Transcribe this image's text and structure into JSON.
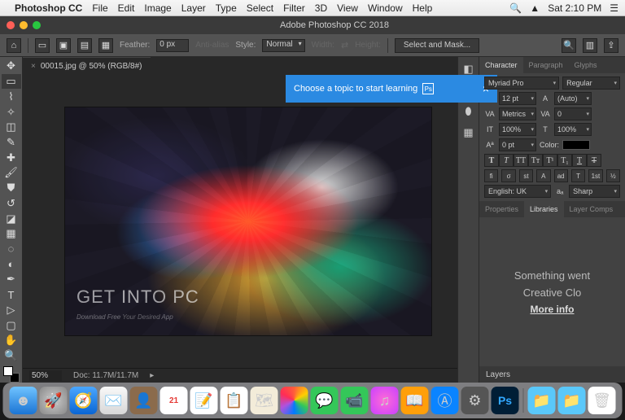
{
  "mac_menu": {
    "app": "Photoshop CC",
    "items": [
      "File",
      "Edit",
      "Image",
      "Layer",
      "Type",
      "Select",
      "Filter",
      "3D",
      "View",
      "Window",
      "Help"
    ],
    "time": "Sat 2:10 PM"
  },
  "window": {
    "title": "Adobe Photoshop CC 2018"
  },
  "options": {
    "feather_label": "Feather:",
    "feather_value": "0 px",
    "antialias_label": "Anti-alias",
    "style_label": "Style:",
    "style_value": "Normal",
    "width_label": "Width:",
    "height_label": "Height:",
    "mask_button": "Select and Mask..."
  },
  "document": {
    "tab_label": "00015.jpg @ 50% (RGB/8#)",
    "watermark": "GET INTO PC",
    "watermark_sub": "Download Free Your Desired App",
    "zoom": "50%",
    "doc_info": "Doc: 11.7M/11.7M"
  },
  "tooltip": {
    "text": "Choose a topic to start learning",
    "badge": "Ps"
  },
  "char_panel": {
    "tabs": [
      "Character",
      "Paragraph",
      "Glyphs"
    ],
    "font": "Myriad Pro",
    "style": "Regular",
    "size": "12 pt",
    "leading": "(Auto)",
    "kerning": "Metrics",
    "tracking": "0",
    "vscale": "100%",
    "hscale": "100%",
    "baseline": "0 pt",
    "color_label": "Color:",
    "lang": "English: UK",
    "aa": "Sharp",
    "type_buttons": [
      "T",
      "T",
      "T",
      "T",
      "T",
      "T",
      "T"
    ],
    "ot_buttons": [
      "fi",
      "σ",
      "st",
      "A",
      "ad",
      "T",
      "1st",
      "½"
    ]
  },
  "lib_panel": {
    "tabs": [
      "Properties",
      "Libraries",
      "Layer Comps"
    ],
    "line1": "Something went",
    "line2": "Creative Clo",
    "link": "More info"
  },
  "layers": {
    "title": "Layers"
  },
  "dock_apps": [
    "finder",
    "launchpad",
    "safari",
    "mail",
    "contacts",
    "calendar",
    "notes",
    "reminders",
    "maps",
    "photos",
    "messages",
    "facetime",
    "itunes",
    "ibooks",
    "appstore",
    "prefs",
    "photoshop"
  ]
}
